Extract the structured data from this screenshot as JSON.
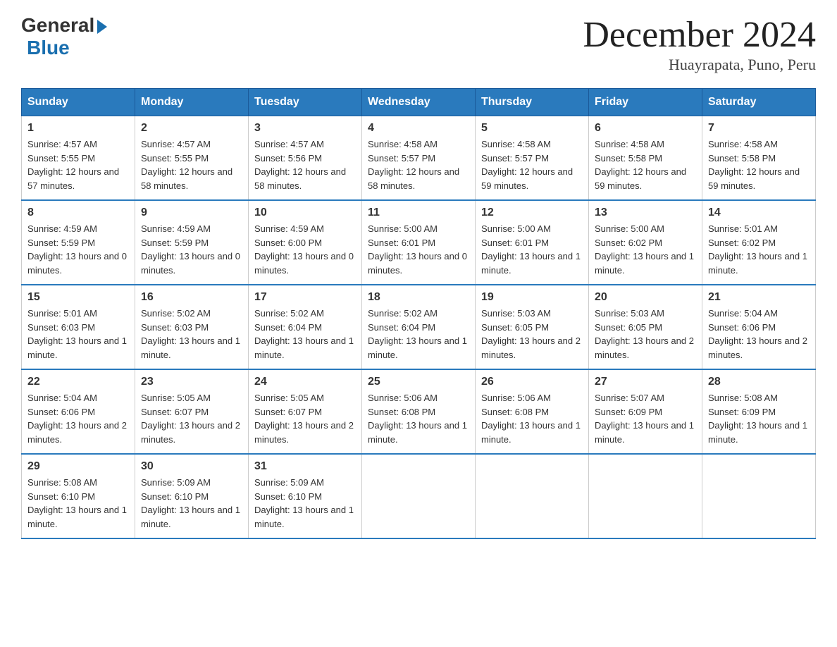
{
  "logo": {
    "general": "General",
    "blue": "Blue"
  },
  "title": "December 2024",
  "subtitle": "Huayrapata, Puno, Peru",
  "days_header": [
    "Sunday",
    "Monday",
    "Tuesday",
    "Wednesday",
    "Thursday",
    "Friday",
    "Saturday"
  ],
  "weeks": [
    [
      {
        "day": "1",
        "sunrise": "4:57 AM",
        "sunset": "5:55 PM",
        "daylight": "12 hours and 57 minutes."
      },
      {
        "day": "2",
        "sunrise": "4:57 AM",
        "sunset": "5:55 PM",
        "daylight": "12 hours and 58 minutes."
      },
      {
        "day": "3",
        "sunrise": "4:57 AM",
        "sunset": "5:56 PM",
        "daylight": "12 hours and 58 minutes."
      },
      {
        "day": "4",
        "sunrise": "4:58 AM",
        "sunset": "5:57 PM",
        "daylight": "12 hours and 58 minutes."
      },
      {
        "day": "5",
        "sunrise": "4:58 AM",
        "sunset": "5:57 PM",
        "daylight": "12 hours and 59 minutes."
      },
      {
        "day": "6",
        "sunrise": "4:58 AM",
        "sunset": "5:58 PM",
        "daylight": "12 hours and 59 minutes."
      },
      {
        "day": "7",
        "sunrise": "4:58 AM",
        "sunset": "5:58 PM",
        "daylight": "12 hours and 59 minutes."
      }
    ],
    [
      {
        "day": "8",
        "sunrise": "4:59 AM",
        "sunset": "5:59 PM",
        "daylight": "13 hours and 0 minutes."
      },
      {
        "day": "9",
        "sunrise": "4:59 AM",
        "sunset": "5:59 PM",
        "daylight": "13 hours and 0 minutes."
      },
      {
        "day": "10",
        "sunrise": "4:59 AM",
        "sunset": "6:00 PM",
        "daylight": "13 hours and 0 minutes."
      },
      {
        "day": "11",
        "sunrise": "5:00 AM",
        "sunset": "6:01 PM",
        "daylight": "13 hours and 0 minutes."
      },
      {
        "day": "12",
        "sunrise": "5:00 AM",
        "sunset": "6:01 PM",
        "daylight": "13 hours and 1 minute."
      },
      {
        "day": "13",
        "sunrise": "5:00 AM",
        "sunset": "6:02 PM",
        "daylight": "13 hours and 1 minute."
      },
      {
        "day": "14",
        "sunrise": "5:01 AM",
        "sunset": "6:02 PM",
        "daylight": "13 hours and 1 minute."
      }
    ],
    [
      {
        "day": "15",
        "sunrise": "5:01 AM",
        "sunset": "6:03 PM",
        "daylight": "13 hours and 1 minute."
      },
      {
        "day": "16",
        "sunrise": "5:02 AM",
        "sunset": "6:03 PM",
        "daylight": "13 hours and 1 minute."
      },
      {
        "day": "17",
        "sunrise": "5:02 AM",
        "sunset": "6:04 PM",
        "daylight": "13 hours and 1 minute."
      },
      {
        "day": "18",
        "sunrise": "5:02 AM",
        "sunset": "6:04 PM",
        "daylight": "13 hours and 1 minute."
      },
      {
        "day": "19",
        "sunrise": "5:03 AM",
        "sunset": "6:05 PM",
        "daylight": "13 hours and 2 minutes."
      },
      {
        "day": "20",
        "sunrise": "5:03 AM",
        "sunset": "6:05 PM",
        "daylight": "13 hours and 2 minutes."
      },
      {
        "day": "21",
        "sunrise": "5:04 AM",
        "sunset": "6:06 PM",
        "daylight": "13 hours and 2 minutes."
      }
    ],
    [
      {
        "day": "22",
        "sunrise": "5:04 AM",
        "sunset": "6:06 PM",
        "daylight": "13 hours and 2 minutes."
      },
      {
        "day": "23",
        "sunrise": "5:05 AM",
        "sunset": "6:07 PM",
        "daylight": "13 hours and 2 minutes."
      },
      {
        "day": "24",
        "sunrise": "5:05 AM",
        "sunset": "6:07 PM",
        "daylight": "13 hours and 2 minutes."
      },
      {
        "day": "25",
        "sunrise": "5:06 AM",
        "sunset": "6:08 PM",
        "daylight": "13 hours and 1 minute."
      },
      {
        "day": "26",
        "sunrise": "5:06 AM",
        "sunset": "6:08 PM",
        "daylight": "13 hours and 1 minute."
      },
      {
        "day": "27",
        "sunrise": "5:07 AM",
        "sunset": "6:09 PM",
        "daylight": "13 hours and 1 minute."
      },
      {
        "day": "28",
        "sunrise": "5:08 AM",
        "sunset": "6:09 PM",
        "daylight": "13 hours and 1 minute."
      }
    ],
    [
      {
        "day": "29",
        "sunrise": "5:08 AM",
        "sunset": "6:10 PM",
        "daylight": "13 hours and 1 minute."
      },
      {
        "day": "30",
        "sunrise": "5:09 AM",
        "sunset": "6:10 PM",
        "daylight": "13 hours and 1 minute."
      },
      {
        "day": "31",
        "sunrise": "5:09 AM",
        "sunset": "6:10 PM",
        "daylight": "13 hours and 1 minute."
      },
      null,
      null,
      null,
      null
    ]
  ],
  "labels": {
    "sunrise": "Sunrise:",
    "sunset": "Sunset:",
    "daylight": "Daylight:"
  }
}
